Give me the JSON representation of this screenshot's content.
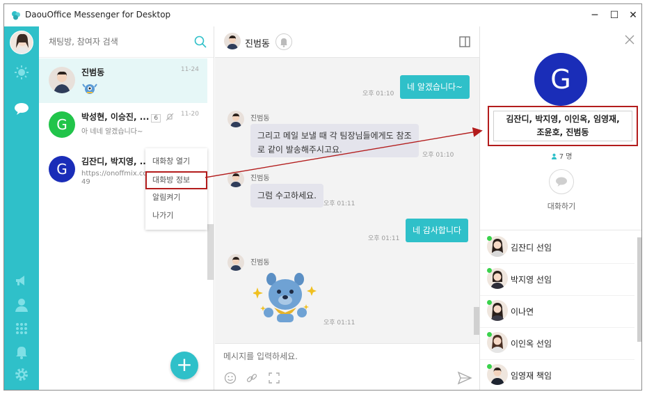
{
  "window": {
    "title": "DaouOffice Messenger for Desktop",
    "controls": {
      "minimize": "─",
      "maximize": "☐",
      "close": "✕"
    }
  },
  "colors": {
    "accent": "#2fc0c9",
    "annotation": "#b31c1c",
    "group_avatar": "#1a2db8",
    "green_avatar": "#21c44a",
    "online": "#3ad24c"
  },
  "rail": {
    "icons": [
      "profile-avatar",
      "sun-icon",
      "chat-bubble-icon",
      "megaphone-icon",
      "person-icon",
      "apps-grid-icon",
      "bell-icon",
      "gear-icon"
    ]
  },
  "search": {
    "placeholder": "채팅방, 참여자 검색"
  },
  "rooms": [
    {
      "name": "진범동",
      "time": "11-24",
      "message": "",
      "avatar": "photo",
      "active": true
    },
    {
      "name": "박성현, 이승진, ...",
      "badge": "6",
      "time": "11-20",
      "message": "아 네네 알겠습니다~",
      "avatar_letter": "G",
      "muted": true
    },
    {
      "name": "김잔디, 박지영, ...",
      "message": "https://onoffmix.com/e",
      "message2": "49",
      "avatar_letter": "G"
    }
  ],
  "context_menu": [
    "대화창 열기",
    "대화방 정보",
    "알림켜기",
    "나가기"
  ],
  "chat": {
    "header_name": "진범동",
    "messages": [
      {
        "from": "me",
        "text": "네 알겠습니다~",
        "time": "오후 01:10"
      },
      {
        "from": "진범동",
        "lines": [
          "그리고 메일 보낼 때 각 팀장님들에게도 참조",
          "로 같이 발송해주시고요."
        ],
        "time": "오후 01:10"
      },
      {
        "from": "진범동",
        "text": "그럼 수고하세요.",
        "time": "오후 01:11"
      },
      {
        "from": "me",
        "text": "네 감사합니다",
        "time": "오후 01:11"
      },
      {
        "from": "진범동",
        "sticker": "blue-bear-sticker",
        "time": "오후 01:11"
      }
    ],
    "composer_placeholder": "메시지를 입력하세요."
  },
  "info": {
    "avatar_letter": "G",
    "room_title_line1": "김잔디, 박지영, 이인옥, 임영재,",
    "room_title_line2": "조윤호, 진범동",
    "member_count": "7 명",
    "chat_action_label": "대화하기",
    "members": [
      "김잔디 선임",
      "박지영 선임",
      "이나연",
      "이인옥 선임",
      "임영재 책임"
    ]
  }
}
